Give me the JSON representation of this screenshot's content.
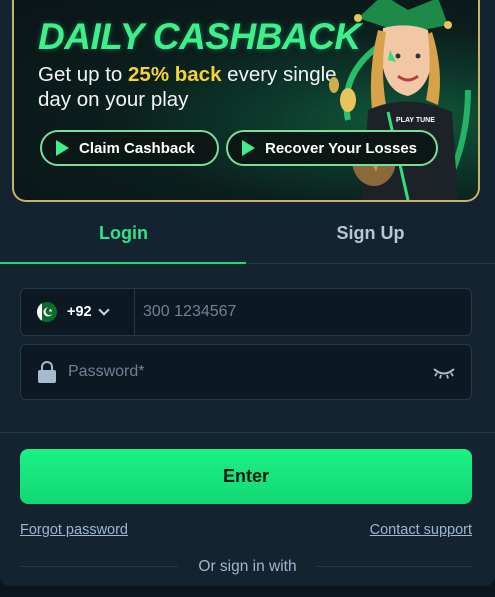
{
  "banner": {
    "title": "DAILY CASHBACK",
    "subtitle_pre": "Get up to ",
    "subtitle_highlight": "25% back",
    "subtitle_post": " every single day on your play",
    "claim_label": "Claim Cashback",
    "recover_label": "Recover Your Losses",
    "mascot_shirt_text": "PLAY TUNE",
    "accent": "#3df08c",
    "highlight_color": "#f3d23a"
  },
  "tabs": [
    {
      "label": "Login",
      "active": true
    },
    {
      "label": "Sign Up",
      "active": false
    }
  ],
  "phone": {
    "country_code": "+92",
    "flag": "pakistan-flag-icon",
    "placeholder": "300 1234567",
    "value": ""
  },
  "password": {
    "placeholder": "Password*",
    "value": "",
    "icon": "lock-icon",
    "toggle_icon": "eye-closed-icon"
  },
  "actions": {
    "enter_label": "Enter",
    "forgot_label": "Forgot password",
    "support_label": "Contact support",
    "or_sign_in": "Or sign in with",
    "enter_color": "#1bf286"
  }
}
